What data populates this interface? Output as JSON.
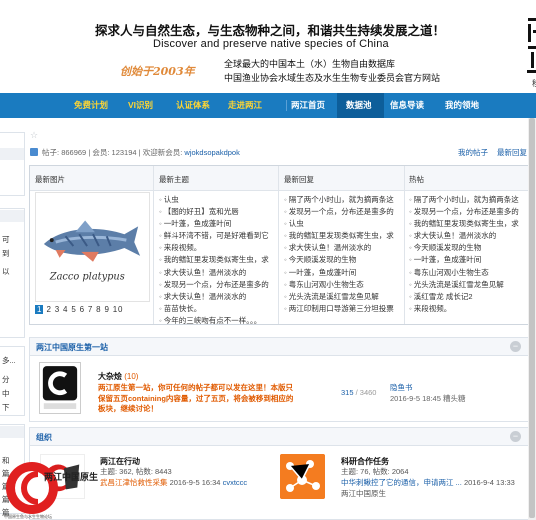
{
  "header": {
    "slogan_cn": "探求人与自然生态，与生态物种之间，和谐共生持续发展之道！",
    "slogan_en": "Discover and preserve native species of China",
    "founded": "创始于2003年",
    "desc_line1": "全球最大的中国本土（水）生物自由数据库",
    "desc_line2": "中国渔业协会水域生态及水生生物专业委员会官方网站",
    "right_partial": "移"
  },
  "nav": [
    {
      "label": "免费计划",
      "style": "yellow"
    },
    {
      "label": "VI识别",
      "style": "yellow"
    },
    {
      "label": "认证体系",
      "style": "yellow"
    },
    {
      "label": "走进两江",
      "style": "yellow"
    },
    {
      "label": "两江首页",
      "style": "white"
    },
    {
      "label": "数据池",
      "style": "white",
      "active": true
    },
    {
      "label": "信息导读",
      "style": "white"
    },
    {
      "label": "我的领地",
      "style": "white"
    }
  ],
  "sidebar": {
    "snippets": [
      "可",
      "到",
      "以",
      "多...",
      "分",
      "中",
      "下",
      "和",
      "篇",
      "篇",
      "篇",
      "篇"
    ]
  },
  "stats": {
    "posts_label": "帖子:",
    "posts": "866969",
    "members_label": "会员:",
    "members": "123194",
    "welcome_label": "欢迎新会员:",
    "new_member": "wjokdsopakdpok",
    "my_posts": "我的帖子",
    "latest_reply": "最新回复"
  },
  "columns": {
    "images_title": "最新图片",
    "topics_title": "最新主题",
    "replies_title": "最新回复",
    "hot_title": "热帖",
    "topics": [
      "认虫",
      "【图的好丑】宽和光唇",
      "一叶蓬，鱼成蓬叶间",
      "鲜斗环湾不错，可是好难看到它",
      "来段视频。",
      "我的鳍缸里发现类似寄生虫，求",
      "求大侠认鱼！温州淡水的",
      "发现另一个点，分布还是蛮多的",
      "求大侠认鱼！温州淡水的",
      "苗苗快长。",
      "今年的三峡吻有点不一样。。。"
    ],
    "replies": [
      "隔了两个小时山，就为摘两条这",
      "发现另一个点，分布还是蛮多的",
      "认虫",
      "我的鳍缸里发现类似寄生虫，求",
      "求大侠认鱼！温州淡水的",
      "今天顺溪发现的生物",
      "一叶蓬，鱼成蓬叶间",
      "粤东山河观小生物生态",
      "光头洗流是溪红雪龙鱼见解",
      "两江印制用口导游第三分坦投票"
    ],
    "hot": [
      "隔了两个小时山，就为摘两条这",
      "发现另一个点，分布还是蛮多的",
      "我的鳍缸里发现类似寄生虫，求",
      "求大侠认鱼！温州淡水的",
      "今天顺溪发现的生物",
      "一叶蓬，鱼成蓬叶间",
      "粤东山河观小生物生态",
      "光头洗流是溪红雪龙鱼见解",
      "溪红雪龙 成长记2",
      "来段视频。"
    ],
    "pager": [
      "1",
      "2",
      "3",
      "4",
      "5",
      "6",
      "7",
      "8",
      "9",
      "10"
    ],
    "pager_current": "1",
    "image_caption": "Zacco platypus"
  },
  "forum_section": {
    "title": "两江中国原生第一站",
    "toggle": "−",
    "forum": {
      "name": "大杂烩",
      "count": "(10)",
      "desc": "两江原生第一站，你可任何的帖子都可以发在这里！本版只保留五页containing内容量，过了五页，将会被移到相应的板块，继续讨论！",
      "topics": "315",
      "posts": "3460",
      "last_title": "隐鱼书",
      "last_meta": "2016-9-5 18:45 糟头糖"
    }
  },
  "groups_section": {
    "title": "组织",
    "toggle": "−",
    "groups": [
      {
        "name": "两江在行动",
        "meta": "主题: 362, 帖数: 8443",
        "post_title": "武昌江津恰救性采集",
        "post_meta": "2016-9-5 16:34",
        "post_user": "cvxtccc"
      },
      {
        "name": "科研合作任务",
        "meta": "主题: 76, 帖数: 2064",
        "post_title": "中华刺鳅控了它的通信，申请两江 ...",
        "post_meta": "2016-9-4 13:33",
        "post_sub": "两江中国原生"
      }
    ]
  },
  "float_badge": {
    "text": "两江中国原生",
    "sub": "中国原生鱼与水生生物论坛"
  },
  "colors": {
    "nav_bg": "#1a7bc0",
    "nav_active": "#0d5e9a",
    "nav_highlight": "#ffd633",
    "link": "#1a5fa8",
    "accent_orange": "#e05a00"
  }
}
